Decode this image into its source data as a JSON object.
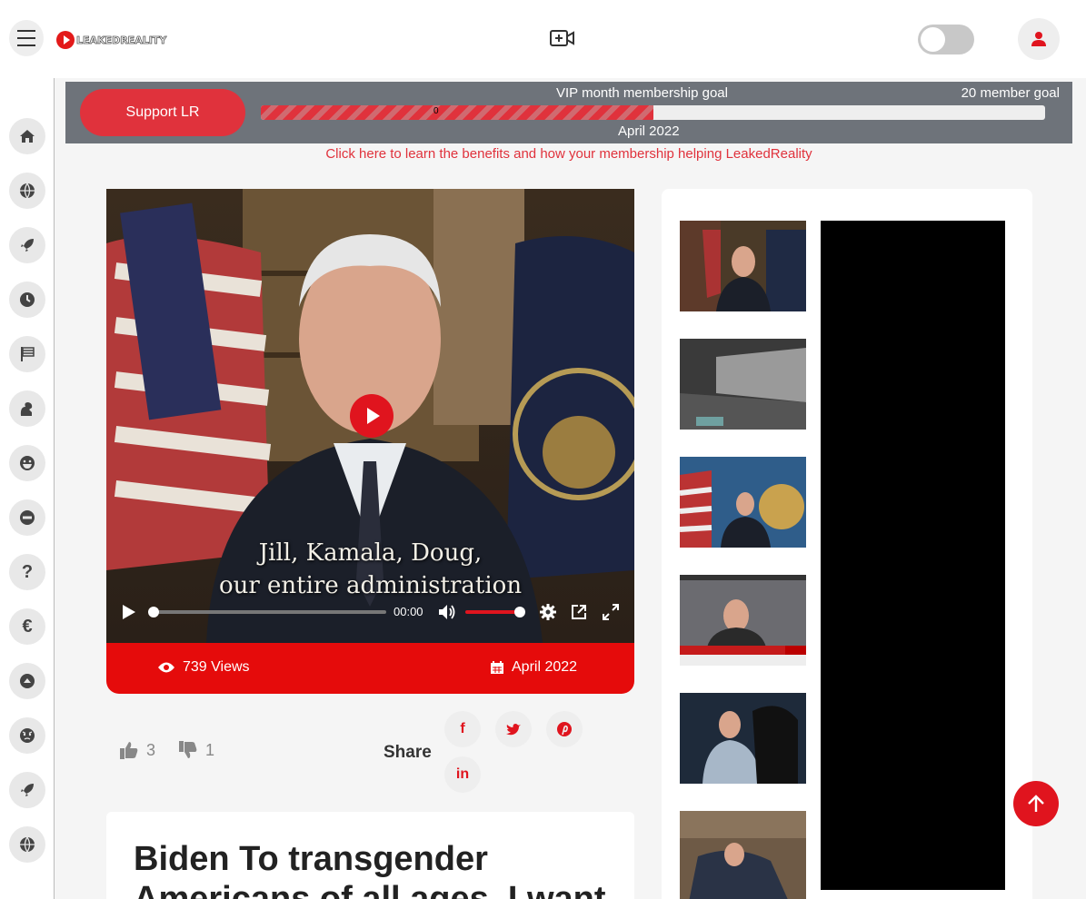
{
  "header": {
    "logo_text": "LEAKEDREALITY",
    "icons": [
      "menu-icon",
      "video-upload-icon",
      "theme-toggle",
      "user-icon"
    ]
  },
  "sidebar": {
    "items": [
      {
        "icon": "home-icon"
      },
      {
        "icon": "globe-icon"
      },
      {
        "icon": "rocket-icon"
      },
      {
        "icon": "clock-icon"
      },
      {
        "icon": "flag-icon"
      },
      {
        "icon": "squirrel-icon"
      },
      {
        "icon": "laugh-icon"
      },
      {
        "icon": "minus-circle-icon"
      },
      {
        "icon": "question-icon",
        "label": "?"
      },
      {
        "icon": "euro-icon",
        "label": "€"
      },
      {
        "icon": "chevron-up-circle-icon"
      },
      {
        "icon": "angry-face-icon"
      },
      {
        "icon": "rocket-icon"
      },
      {
        "icon": "globe-icon"
      }
    ]
  },
  "banner": {
    "support_label": "Support LR",
    "goal_title": "VIP month membership goal",
    "goal_target": "20 member goal",
    "progress_value": "0",
    "progress_fraction": 0.5,
    "month": "April 2022",
    "link_text": "Click here to learn the benefits and how your membership helping LeakedReality"
  },
  "video": {
    "caption_line1": "Jill, Kamala, Doug,",
    "caption_line2": "our entire administration",
    "time": "00:00",
    "volume_fraction": 1.0,
    "views": "739 Views",
    "date": "April 2022"
  },
  "reactions": {
    "likes": "3",
    "dislikes": "1",
    "share_label": "Share",
    "share_buttons": [
      "f",
      "t",
      "p",
      "in"
    ]
  },
  "article": {
    "title": "Biden To transgender Americans of all ages, I want"
  },
  "colors": {
    "accent": "#e0141e",
    "banner_bg": "#6e737a",
    "support_btn": "#e0323c"
  }
}
